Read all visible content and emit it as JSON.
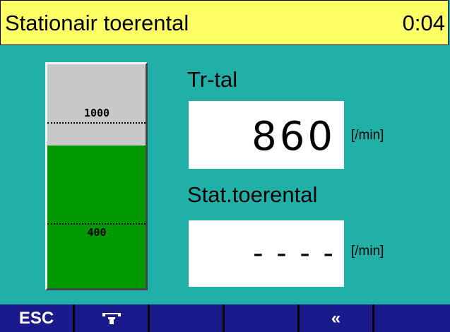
{
  "header": {
    "title": "Stationair toerental",
    "time": "0:04"
  },
  "gauge": {
    "marks": [
      "1000",
      "400"
    ]
  },
  "fields": {
    "speed": {
      "label": "Tr-tal",
      "value": "860",
      "unit": "[/min]"
    },
    "idle": {
      "label": "Stat.toerental",
      "value": "- - - -",
      "unit": "[/min]"
    }
  },
  "softkeys": [
    {
      "label": "ESC",
      "icon": ""
    },
    {
      "label": "",
      "icon": "print-icon"
    },
    {
      "label": "",
      "icon": ""
    },
    {
      "label": "",
      "icon": ""
    },
    {
      "label": "«",
      "icon": ""
    },
    {
      "label": "",
      "icon": ""
    }
  ],
  "colors": {
    "background": "#21b0a8",
    "titlebar": "#ffff66",
    "gauge_fill": "#009900",
    "gauge_empty": "#c8c8c8",
    "softkey": "#1a1a8c"
  }
}
